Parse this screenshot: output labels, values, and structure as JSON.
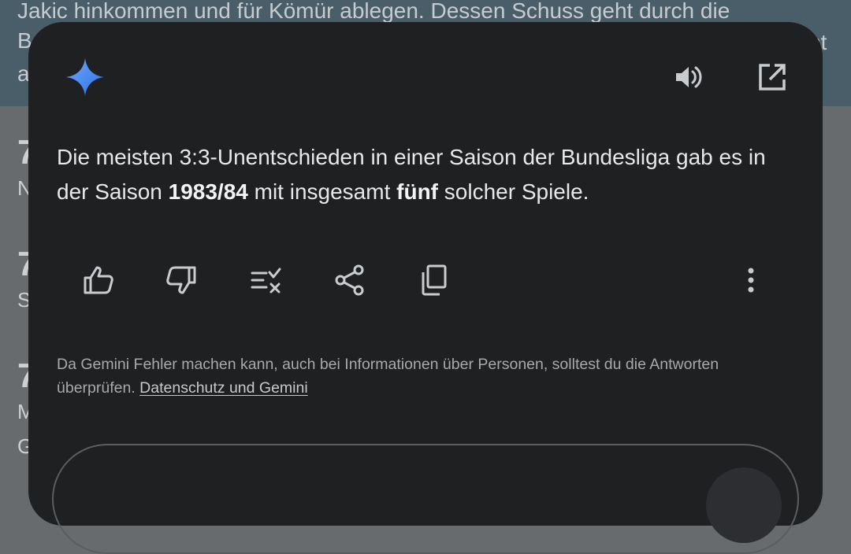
{
  "background": {
    "line1": "Jakic hinkommen und für Kömür ablegen. Dessen Schuss geht durch die",
    "line2": "Be",
    "line2_right": "ht",
    "line3": "a",
    "items": [
      {
        "num": "7",
        "sub": "N"
      },
      {
        "num": "7",
        "sub": "S"
      },
      {
        "num": "7",
        "sub": "M",
        "sub2": "G"
      }
    ]
  },
  "sheet": {
    "icons": {
      "logo": "gemini-sparkle-icon",
      "speaker": "speaker-icon",
      "open": "open-in-new-icon"
    },
    "answer": {
      "part1": "Die meisten 3:3-Unentschieden in einer Saison der Bundesliga gab es in der Saison ",
      "bold1": "1983/84",
      "part2": " mit insgesamt ",
      "bold2": "fünf",
      "part3": " solcher Spiele."
    },
    "actions": [
      "thumbs-up-icon",
      "thumbs-down-icon",
      "double-check-icon",
      "share-icon",
      "copy-icon",
      "more-vert-icon"
    ],
    "disclaimer": {
      "text": "Da Gemini Fehler machen kann, auch bei Informationen über Personen, solltest du die Antworten überprüfen. ",
      "link": "Datenschutz und Gemini"
    }
  },
  "colors": {
    "sheet_bg": "#1f2022",
    "text": "#e6e8ea",
    "muted": "#a7aaad",
    "accent": "#4285f4"
  }
}
